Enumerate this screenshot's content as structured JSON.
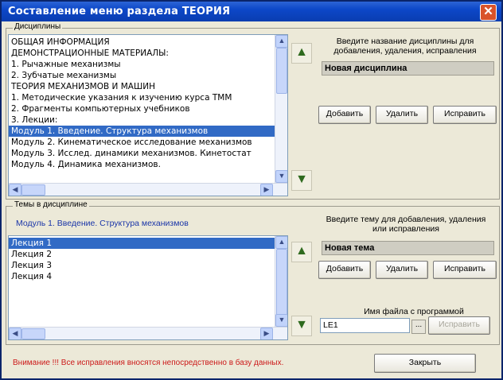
{
  "window": {
    "title": "Составление меню раздела ТЕОРИЯ",
    "close_glyph": "✕"
  },
  "disciplines": {
    "group_label": "Дисциплины",
    "items": [
      {
        "label": "ОБЩАЯ ИНФОРМАЦИЯ",
        "selected": false
      },
      {
        "label": "ДЕМОНСТРАЦИОННЫЕ МАТЕРИАЛЫ:",
        "selected": false
      },
      {
        "label": "1. Рычажные механизмы",
        "selected": false
      },
      {
        "label": "2. Зубчатые механизмы",
        "selected": false
      },
      {
        "label": "ТЕОРИЯ МЕХАНИЗМОВ И МАШИН",
        "selected": false
      },
      {
        "label": "1. Методические указания к изучению курса ТММ",
        "selected": false
      },
      {
        "label": "2. Фрагменты компьютерных учебников",
        "selected": false
      },
      {
        "label": "3. Лекции:",
        "selected": false
      },
      {
        "label": "Модуль 1. Введение. Структура механизмов",
        "selected": true
      },
      {
        "label": "Модуль 2. Кинематическое исследование механизмов",
        "selected": false
      },
      {
        "label": "Модуль 3. Исслед. динамики механизмов. Кинетостат",
        "selected": false
      },
      {
        "label": "Модуль 4. Динамика механизмов.",
        "selected": false
      }
    ],
    "prompt": "Введите название дисциплины для добавления, удаления, исправления",
    "input_value": "Новая дисциплина",
    "add_label": "Добавить",
    "delete_label": "Удалить",
    "fix_label": "Исправить",
    "up_icon": "arrow-up-icon",
    "down_icon": "arrow-down-icon"
  },
  "topics": {
    "group_label": "Темы в дисциплине",
    "current_discipline": "Модуль 1. Введение. Структура механизмов",
    "items": [
      {
        "label": "Лекция 1",
        "selected": true
      },
      {
        "label": "Лекция 2",
        "selected": false
      },
      {
        "label": "Лекция 3",
        "selected": false
      },
      {
        "label": "Лекция 4",
        "selected": false
      }
    ],
    "prompt": "Введите тему для добавления, удаления или исправления",
    "input_value": "Новая тема",
    "add_label": "Добавить",
    "delete_label": "Удалить",
    "fix_label": "Исправить",
    "file_label": "Имя файла с программой",
    "file_value": "LE1",
    "browse_label": "...",
    "file_fix_label": "Исправить"
  },
  "footer": {
    "warning": "Внимание !!! Все исправления вносятся непосредственно в базу данных.",
    "close_label": "Закрыть"
  },
  "colors": {
    "title_bar": "#0c47c8",
    "selection": "#316ac5",
    "warning": "#cc1a1a",
    "discipline_name": "#1a35a8"
  }
}
